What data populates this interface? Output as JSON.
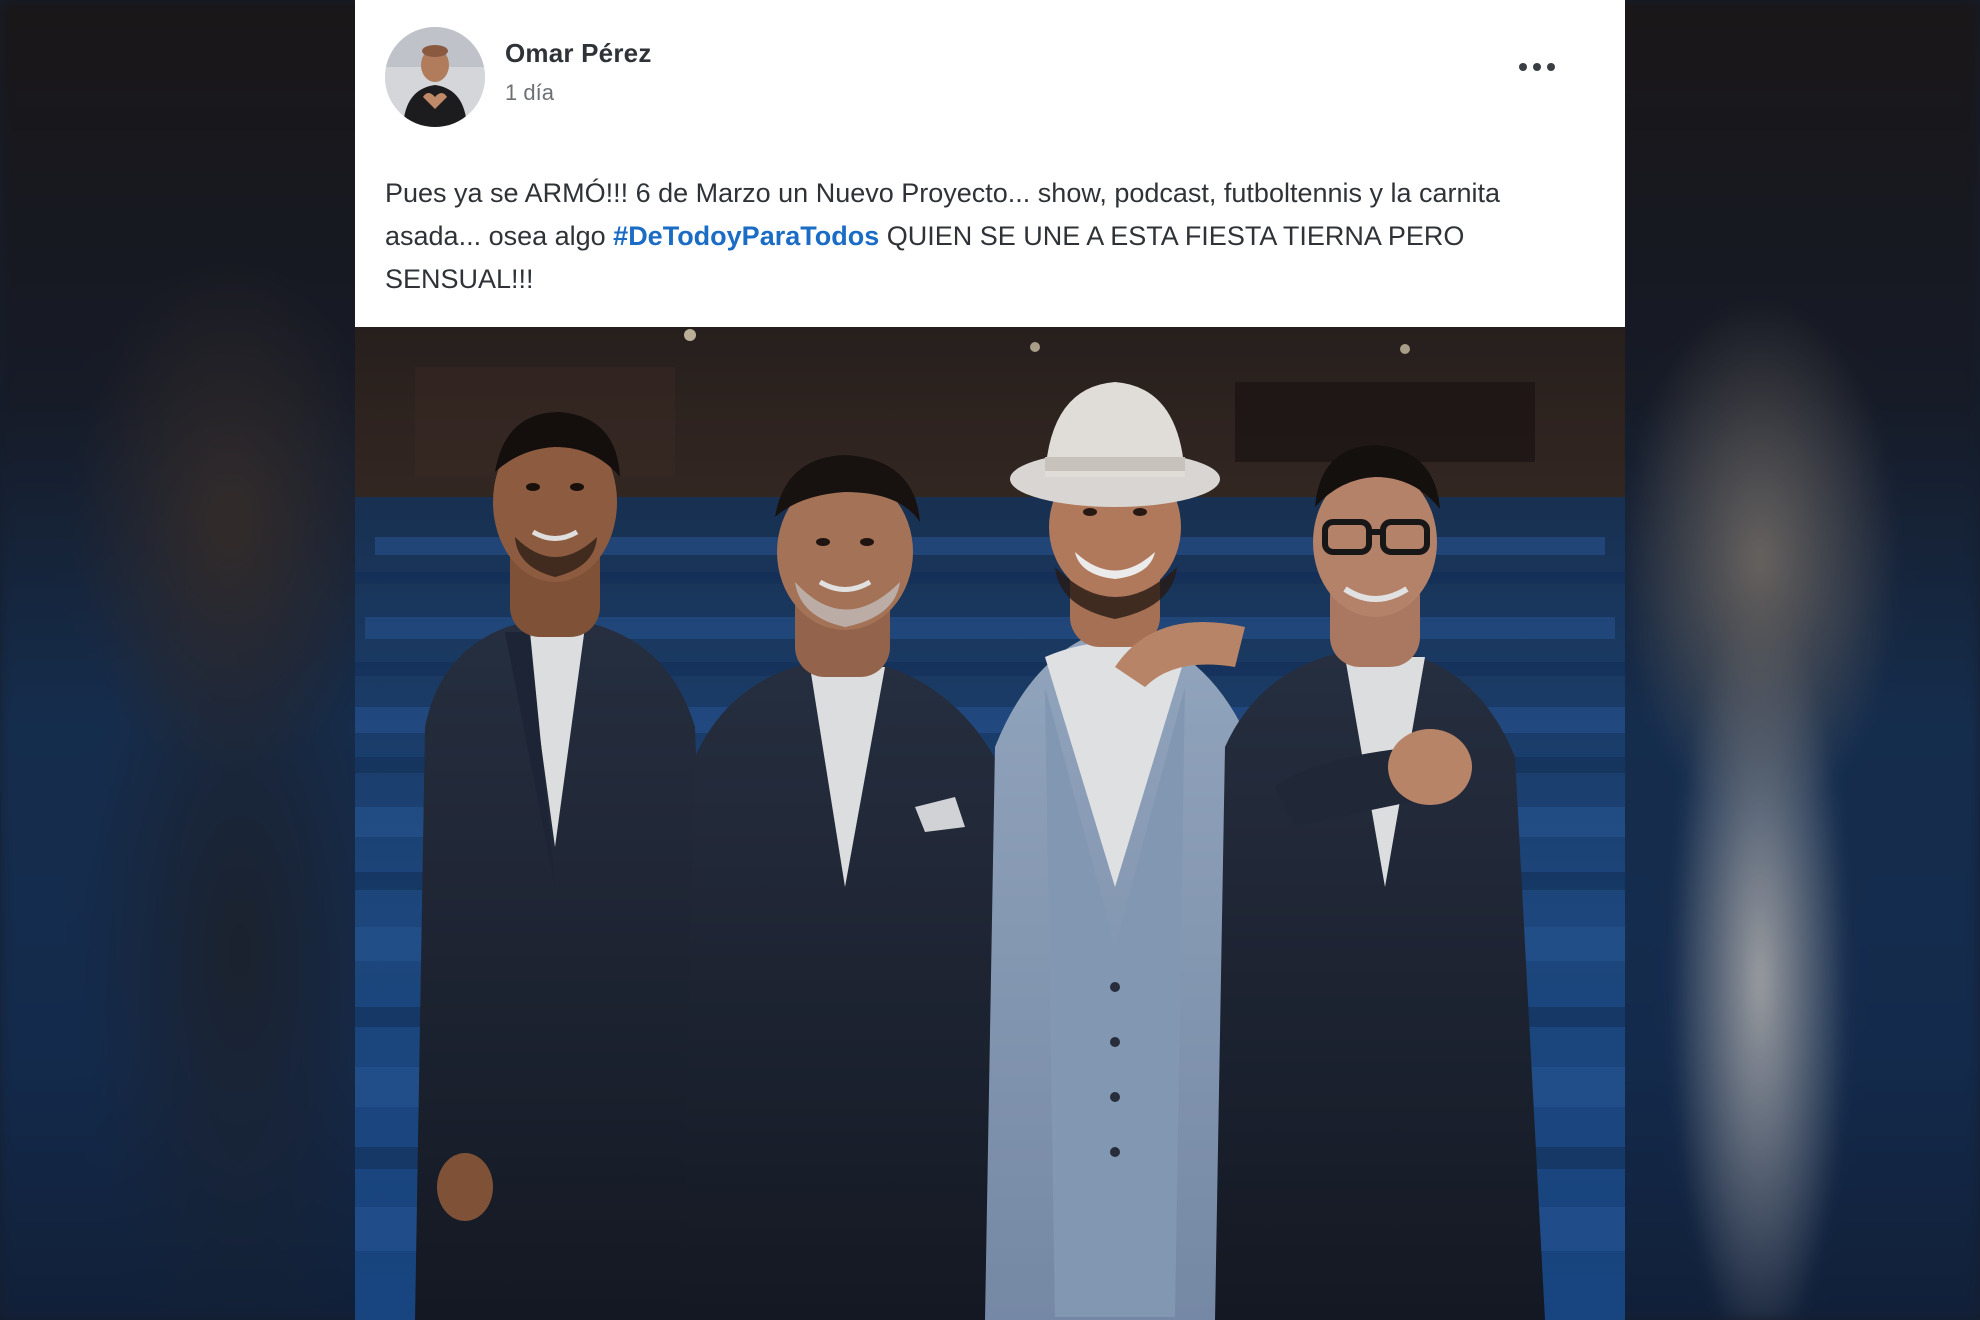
{
  "post": {
    "author": {
      "name": "Omar Pérez"
    },
    "time": "1 día",
    "text": {
      "before_hashtag": "Pues ya se ARMÓ!!! 6 de Marzo un Nuevo Proyecto... show, podcast, futboltennis y la carnita asada... osea algo ",
      "hashtag": "#DeTodoyParaTodos",
      "after_hashtag": " QUIEN SE UNE A ESTA FIESTA TIERNA PERO SENSUAL!!!"
    },
    "more_icon": "more-horizontal-icon",
    "photo": {
      "subject": "four-men-in-theater-photo"
    }
  },
  "colors": {
    "card_bg": "#ffffff",
    "text": "#2f3337",
    "muted": "#6d7175",
    "hashtag": "#1a6cc4",
    "seat_blue": "#1e4f8f"
  }
}
